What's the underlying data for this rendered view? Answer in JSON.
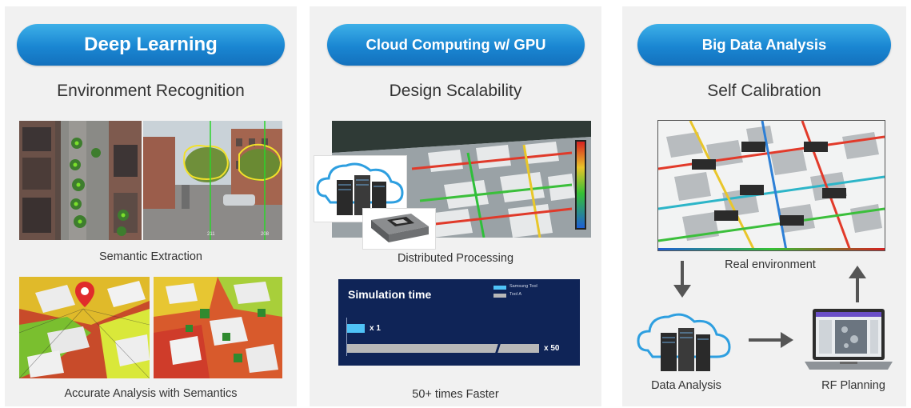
{
  "panels": [
    {
      "pill": "Deep Learning",
      "subtitle": "Environment Recognition",
      "caption_mid": "Semantic Extraction",
      "caption_bottom": "Accurate Analysis with Semantics",
      "street_labels": [
        "211",
        "208"
      ]
    },
    {
      "pill": "Cloud Computing w/ GPU",
      "subtitle": "Design Scalability",
      "caption_mid": "Distributed Processing",
      "caption_bottom": "50+ times Faster",
      "sim_card": {
        "title": "Simulation time",
        "legend": [
          {
            "name": "Samsung Tool",
            "color": "#4fc3f7"
          },
          {
            "name": "Tool A",
            "color": "#b8b8b8"
          }
        ],
        "bars": [
          {
            "label": "x 1",
            "relative_time": 1
          },
          {
            "label": "x 50",
            "relative_time": 50
          }
        ]
      }
    },
    {
      "pill": "Big Data Analysis",
      "subtitle": "Self Calibration",
      "caption_env": "Real environment",
      "label_analysis": "Data Analysis",
      "label_planning": "RF Planning"
    }
  ],
  "colors": {
    "accent": "#1a86d2",
    "panel_bg": "#f1f1f1",
    "sim_card_bg": "#0f2457"
  },
  "icons": [
    "cloud-server-icon",
    "gpu-chip-icon",
    "laptop-icon",
    "arrow-down-icon",
    "arrow-right-icon",
    "arrow-up-icon",
    "location-pin-icon",
    "color-scale-bar"
  ]
}
